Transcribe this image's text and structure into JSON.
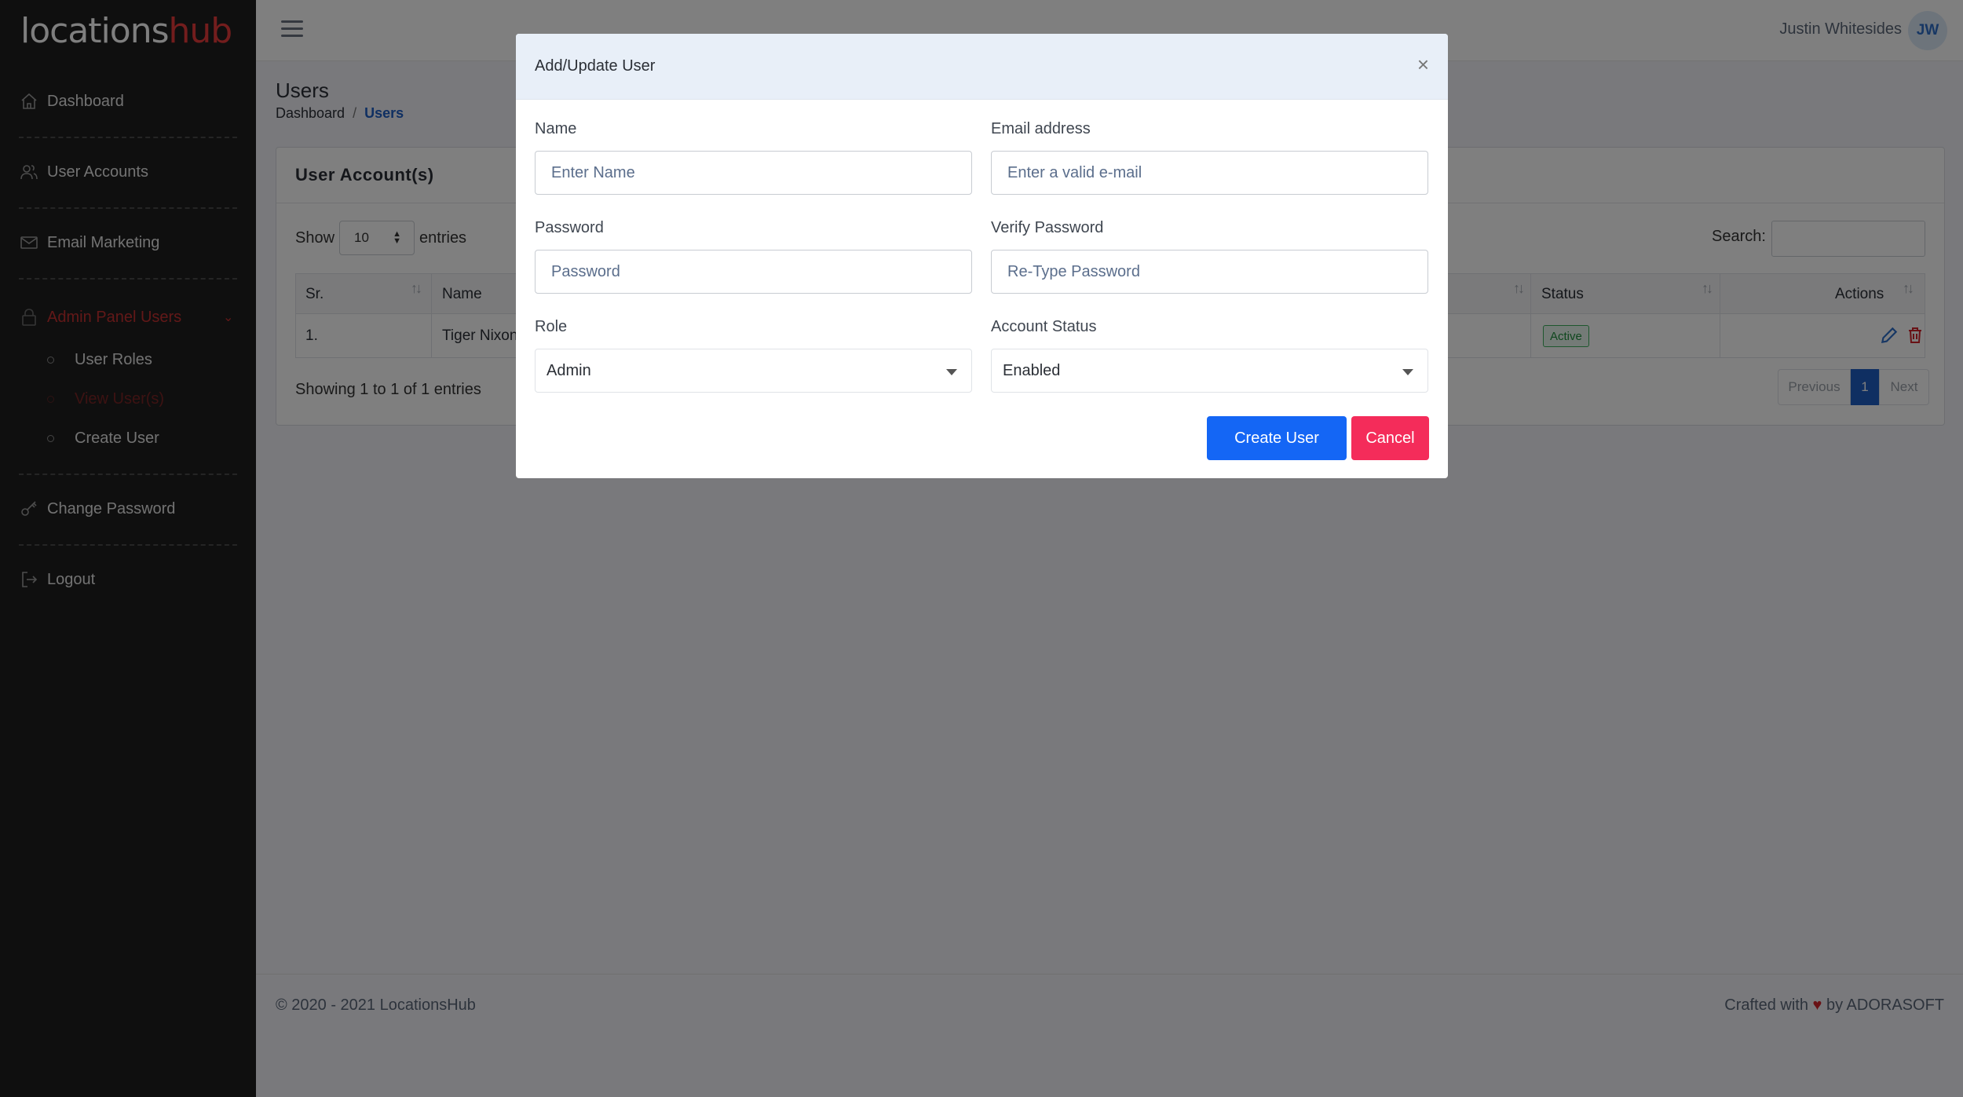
{
  "brand": {
    "part1": "locations",
    "part2": "hub"
  },
  "sidebar": {
    "items": [
      {
        "label": "Dashboard",
        "icon": "home-icon"
      },
      {
        "label": "User Accounts",
        "icon": "users-icon"
      },
      {
        "label": "Email Marketing",
        "icon": "mail-icon"
      },
      {
        "label": "Admin Panel Users",
        "icon": "lock-icon"
      },
      {
        "label": "Change Password",
        "icon": "key-icon"
      },
      {
        "label": "Logout",
        "icon": "logout-icon"
      }
    ],
    "subitems": [
      {
        "label": "User Roles"
      },
      {
        "label": "View User(s)"
      },
      {
        "label": "Create User"
      }
    ]
  },
  "topbar": {
    "user_name": "Justin Whitesides",
    "avatar_initials": "JW"
  },
  "page": {
    "title": "Users",
    "breadcrumb": {
      "home": "Dashboard",
      "sep": "/",
      "current": "Users"
    }
  },
  "card": {
    "title": "User Account(s)",
    "show_label": "Show",
    "page_length": "10",
    "entries_label": "entries",
    "search_label": "Search:",
    "columns": {
      "sr": "Sr.",
      "name": "Name",
      "status": "Status",
      "actions": "Actions"
    },
    "rows": [
      {
        "sr": "1.",
        "name": "Tiger Nixon",
        "status": "Active"
      }
    ],
    "info": "Showing 1 to 1 of 1 entries",
    "pager": {
      "prev": "Previous",
      "page": "1",
      "next": "Next"
    }
  },
  "footer": {
    "copyright": "© 2020 - 2021 LocationsHub",
    "crafted_prefix": "Crafted with",
    "heart": "♥",
    "crafted_suffix": "by ADORASOFT"
  },
  "modal": {
    "title": "Add/Update User",
    "close": "×",
    "fields": {
      "name": {
        "label": "Name",
        "placeholder": "Enter Name"
      },
      "email": {
        "label": "Email address",
        "placeholder": "Enter a valid e-mail"
      },
      "password": {
        "label": "Password",
        "placeholder": "Password"
      },
      "verify": {
        "label": "Verify Password",
        "placeholder": "Re-Type Password"
      },
      "role": {
        "label": "Role",
        "value": "Admin"
      },
      "status": {
        "label": "Account Status",
        "value": "Enabled"
      }
    },
    "buttons": {
      "create": "Create User",
      "cancel": "Cancel"
    }
  },
  "colors": {
    "sidebar_bg": "#1f1f1f",
    "brand_accent": "#e63b3b",
    "primary": "#1466f5",
    "danger": "#f42c5a",
    "link": "#1f5fc5",
    "success": "#1e8f3c"
  }
}
